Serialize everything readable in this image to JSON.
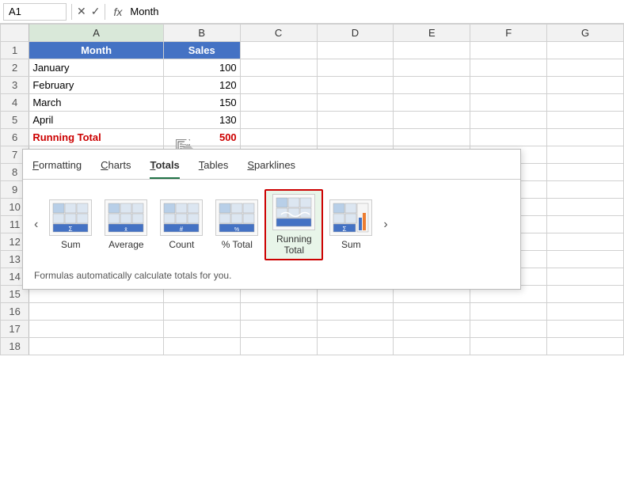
{
  "formula_bar": {
    "name_box": "A1",
    "formula_text": "Month",
    "fx_label": "fx"
  },
  "columns": [
    "",
    "A",
    "B",
    "C",
    "D",
    "E",
    "F",
    "G"
  ],
  "rows": [
    {
      "num": "",
      "a": "Month",
      "b": "Sales",
      "type": "header"
    },
    {
      "num": "2",
      "a": "January",
      "b": "100",
      "type": "data"
    },
    {
      "num": "3",
      "a": "February",
      "b": "120",
      "type": "data"
    },
    {
      "num": "4",
      "a": "March",
      "b": "150",
      "type": "data"
    },
    {
      "num": "5",
      "a": "April",
      "b": "130",
      "type": "data"
    },
    {
      "num": "6",
      "a": "Running Total",
      "b": "500",
      "type": "running"
    }
  ],
  "extra_rows": [
    "16",
    "17",
    "18"
  ],
  "popup": {
    "tabs": [
      {
        "id": "formatting",
        "label": "Formatting",
        "underline": "F",
        "active": false
      },
      {
        "id": "charts",
        "label": "Charts",
        "underline": "C",
        "active": false
      },
      {
        "id": "totals",
        "label": "Totals",
        "underline": "T",
        "active": true
      },
      {
        "id": "tables",
        "label": "Tables",
        "underline": "T2",
        "active": false
      },
      {
        "id": "sparklines",
        "label": "Sparklines",
        "underline": "S",
        "active": false
      }
    ],
    "icons": [
      {
        "id": "sum",
        "label": "Sum",
        "symbol": "Σ",
        "selected": false
      },
      {
        "id": "average",
        "label": "Average",
        "symbol": "x̄",
        "selected": false
      },
      {
        "id": "count",
        "label": "Count",
        "symbol": "#",
        "selected": false
      },
      {
        "id": "pct-total",
        "label": "% Total",
        "symbol": "%",
        "selected": false
      },
      {
        "id": "running-total",
        "label": "Running\nTotal",
        "symbol": "∿",
        "selected": true
      },
      {
        "id": "sum2",
        "label": "Sum",
        "symbol": "Σ",
        "selected": false
      }
    ],
    "footer": "Formulas automatically calculate totals for you."
  },
  "colors": {
    "header_bg": "#4472c4",
    "header_text": "#ffffff",
    "running_color": "#cc0000",
    "running_border": "#ee0000",
    "active_tab_color": "#217346",
    "selected_icon_bg": "#e8f5e9",
    "selected_icon_border": "#cc0000"
  }
}
